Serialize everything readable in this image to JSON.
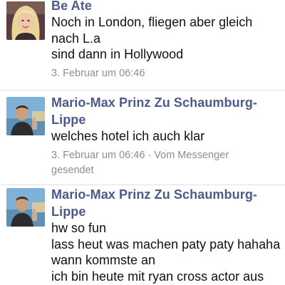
{
  "messages": [
    {
      "sender": "Be Ate",
      "lines": [
        "Noch in London, fliegen aber gleich",
        "nach L.a",
        "sind dann in Hollywood"
      ],
      "meta": "3. Februar um 06:46"
    },
    {
      "sender_lines": [
        "Mario-Max Prinz Zu Schaumburg-",
        "Lippe"
      ],
      "lines": [
        "welches hotel ich auch klar"
      ],
      "meta_lines": [
        "3. Februar um 06:46 · Vom Messenger",
        "gesendet"
      ]
    },
    {
      "sender_lines": [
        "Mario-Max Prinz Zu Schaumburg-",
        "Lippe"
      ],
      "lines": [
        "hw so fun",
        "lass heut was machen paty paty hahaha",
        "wann kommste an",
        "ich bin heute mit ryan cross actor aus"
      ]
    }
  ]
}
